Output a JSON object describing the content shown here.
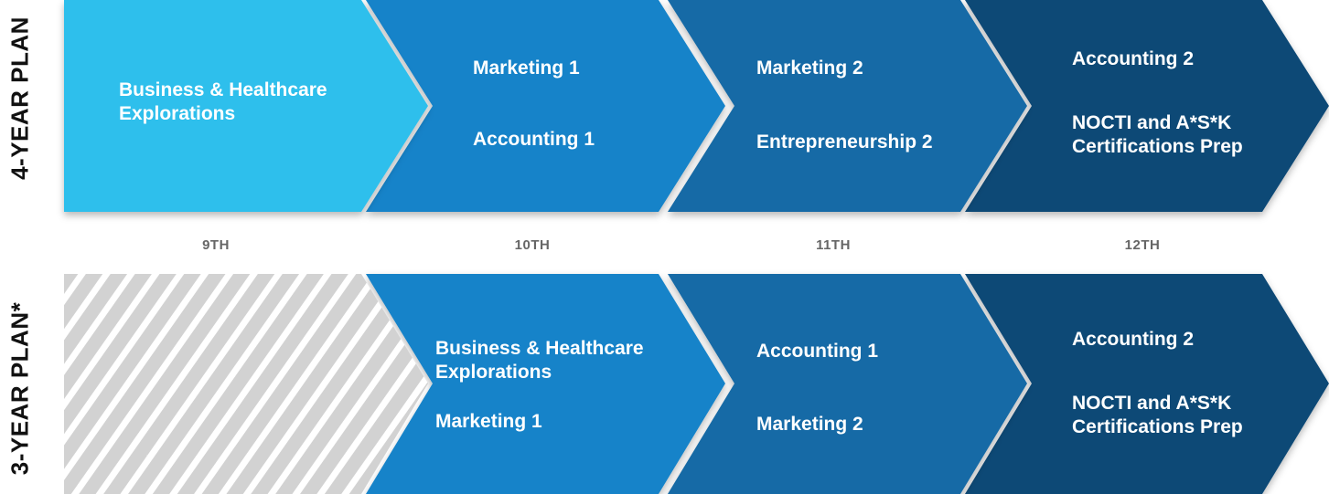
{
  "plan_4yr": {
    "title": "4-YEAR PLAN",
    "stages": [
      {
        "lines": [
          "Business & Healthcare",
          "Explorations"
        ]
      },
      {
        "lines": [
          "Marketing 1",
          "Accounting 1"
        ]
      },
      {
        "lines": [
          "Marketing 2",
          "Entrepreneurship 2"
        ]
      },
      {
        "lines": [
          "Accounting 2",
          "NOCTI and A*S*K",
          "Certifications Prep"
        ]
      }
    ]
  },
  "plan_3yr": {
    "title": "3-YEAR PLAN*",
    "stages": [
      {
        "lines": [
          "Business & Healthcare",
          "Explorations",
          "Marketing 1"
        ]
      },
      {
        "lines": [
          "Accounting 1",
          "Marketing 2"
        ]
      },
      {
        "lines": [
          "Accounting 2",
          "NOCTI and A*S*K",
          "Certifications Prep"
        ]
      }
    ]
  },
  "years": [
    "9TH",
    "10TH",
    "11TH",
    "12TH"
  ],
  "colors": {
    "stage_1": "#2fbfec",
    "stage_2": "#1483c9",
    "stage_3": "#166ba6",
    "stage_4": "#114a76",
    "hatch_bg": "#d2d2d2",
    "hatch_stripe": "#ffffff",
    "year_text": "#666666",
    "plan_text": "#111111"
  }
}
